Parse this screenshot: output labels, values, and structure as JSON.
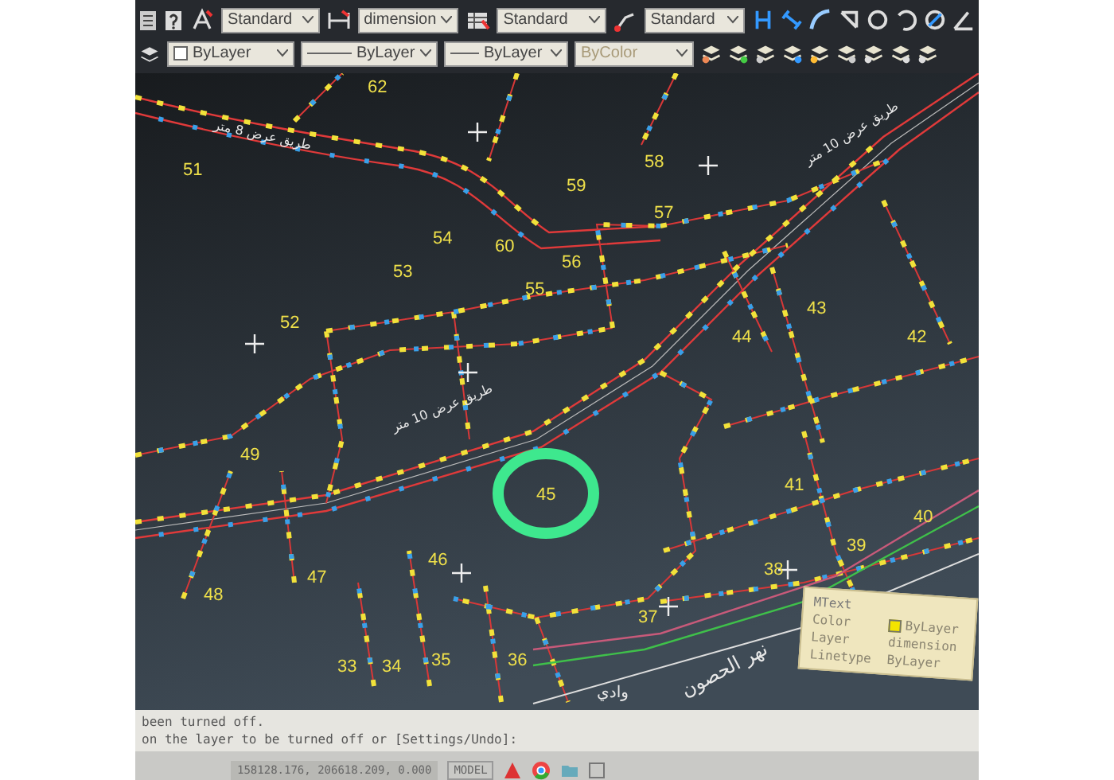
{
  "toolbar": {
    "styles": [
      {
        "kind": "text",
        "value": "Standard"
      },
      {
        "kind": "dimension",
        "value": "dimension"
      },
      {
        "kind": "table",
        "value": "Standard"
      },
      {
        "kind": "multileader",
        "value": "Standard"
      }
    ],
    "properties": [
      {
        "kind": "color",
        "value": "ByLayer",
        "disabled": false
      },
      {
        "kind": "linetype",
        "value": "ByLayer",
        "disabled": false
      },
      {
        "kind": "lineweight",
        "value": "ByLayer",
        "disabled": false
      },
      {
        "kind": "plotstyle",
        "value": "ByColor",
        "disabled": true
      }
    ]
  },
  "drawing": {
    "parcels": [
      "62",
      "51",
      "58",
      "59",
      "60",
      "57",
      "54",
      "53",
      "56",
      "55",
      "43",
      "42",
      "44",
      "52",
      "49",
      "45",
      "41",
      "40",
      "39",
      "38",
      "46",
      "47",
      "48",
      "37",
      "33",
      "34",
      "35",
      "36"
    ],
    "road_labels": [
      "طريق عرض 8 متر",
      "طريق عرض 10 متر",
      "طريق عرض 10 متر"
    ],
    "place_labels": [
      "وادي",
      "نهر الحصون"
    ],
    "tooltip": {
      "title": "MText",
      "rows": [
        {
          "kind": "color",
          "label": "Color",
          "value": "ByLayer"
        },
        {
          "kind": "text",
          "label": "Layer",
          "value": "dimension"
        },
        {
          "kind": "text",
          "label": "Linetype",
          "value": "ByLayer"
        }
      ]
    }
  },
  "command_lines": [
    "been turned off.",
    "on the layer to be turned off or [Settings/Undo]:"
  ],
  "status_bar": {
    "coordinates": "158128.176, 206618.209, 0.000",
    "mode": "MODEL"
  }
}
